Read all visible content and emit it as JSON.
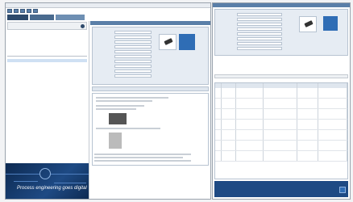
{
  "window_title": "",
  "toolbar": {
    "buttons": [
      "new-icon",
      "save-icon",
      "print-icon",
      "refresh-icon",
      "settings-icon"
    ]
  },
  "tabs": [],
  "banner": {
    "slogan": "Process engineering goes digital"
  },
  "colors": {
    "accent": "#5a7fa8",
    "banner": "#1e4a84",
    "button": "#2f6db5"
  }
}
